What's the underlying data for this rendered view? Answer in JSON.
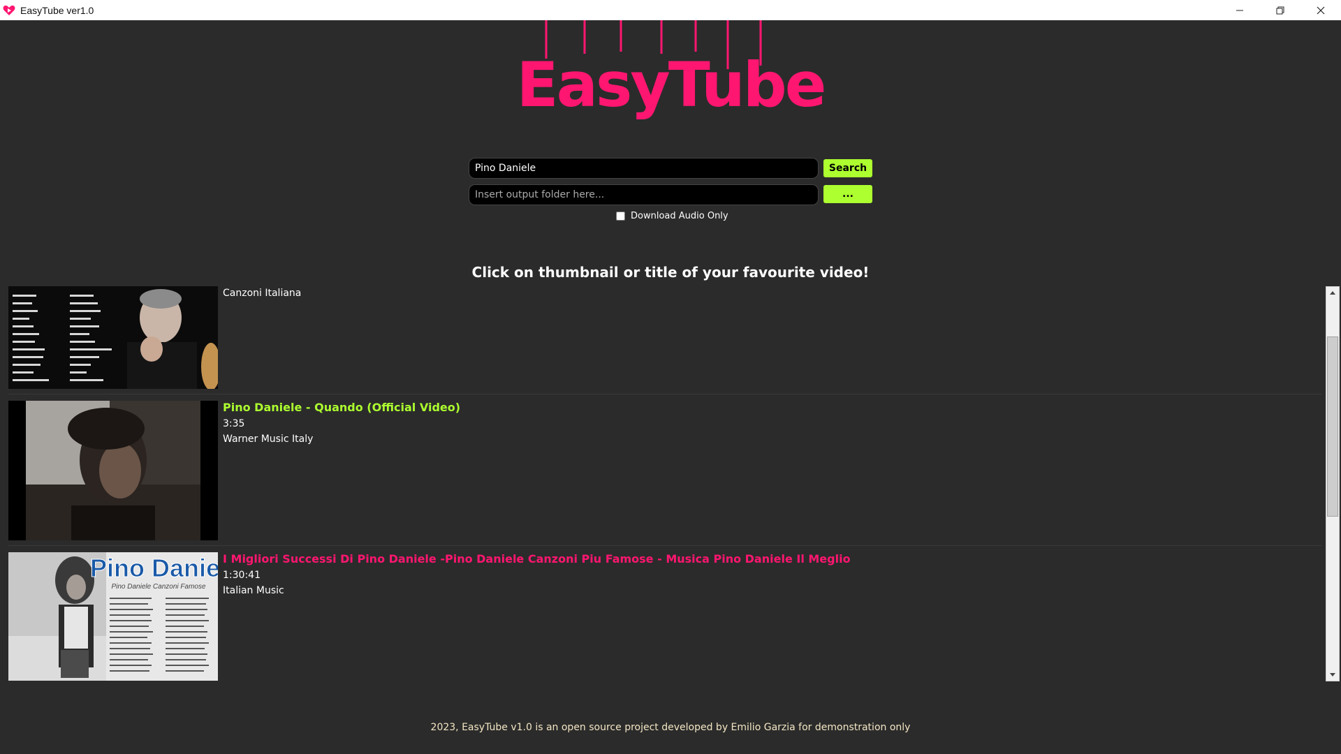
{
  "window": {
    "title": "EasyTube ver1.0",
    "icon": "heart-play-icon",
    "controls": [
      "minimize-icon",
      "restore-icon",
      "close-icon"
    ]
  },
  "logo": {
    "text": "EasyTube",
    "color": "#ff1670"
  },
  "search": {
    "value": "Pino Daniele",
    "button_label": "Search"
  },
  "folder": {
    "placeholder": "Insert output folder here...",
    "button_label": "..."
  },
  "audio_only": {
    "label": "Download Audio Only",
    "checked": false
  },
  "instruction": "Click on thumbnail or title of your favourite video!",
  "results": [
    {
      "title": "Canzoni Italiana",
      "duration": "",
      "channel": "",
      "thumbnail": "tracklist-portrait-thumbnail"
    },
    {
      "title": "Pino Daniele - Quando (Official Video)",
      "title_color": "#adff2f",
      "duration": "3:35",
      "channel": "Warner Music Italy",
      "thumbnail": "video-still-thumbnail"
    },
    {
      "title": "I Migliori Successi Di Pino Daniele -Pino Daniele Canzoni Piu Famose - Musica Pino Daniele Il Meglio",
      "title_color": "#ff1670",
      "duration": "1:30:41",
      "channel": "Italian Music",
      "thumbnail": "album-cover-thumbnail",
      "thumb_heading": "Pino Daniele",
      "thumb_subheading": "Pino Daniele Canzoni Famose"
    }
  ],
  "footer": "2023, EasyTube v1.0 is an open source project developed by Emilio Garzia for demonstration only",
  "colors": {
    "background": "#2b2b2b",
    "accent_green": "#adff2f",
    "accent_pink": "#ff1670"
  }
}
